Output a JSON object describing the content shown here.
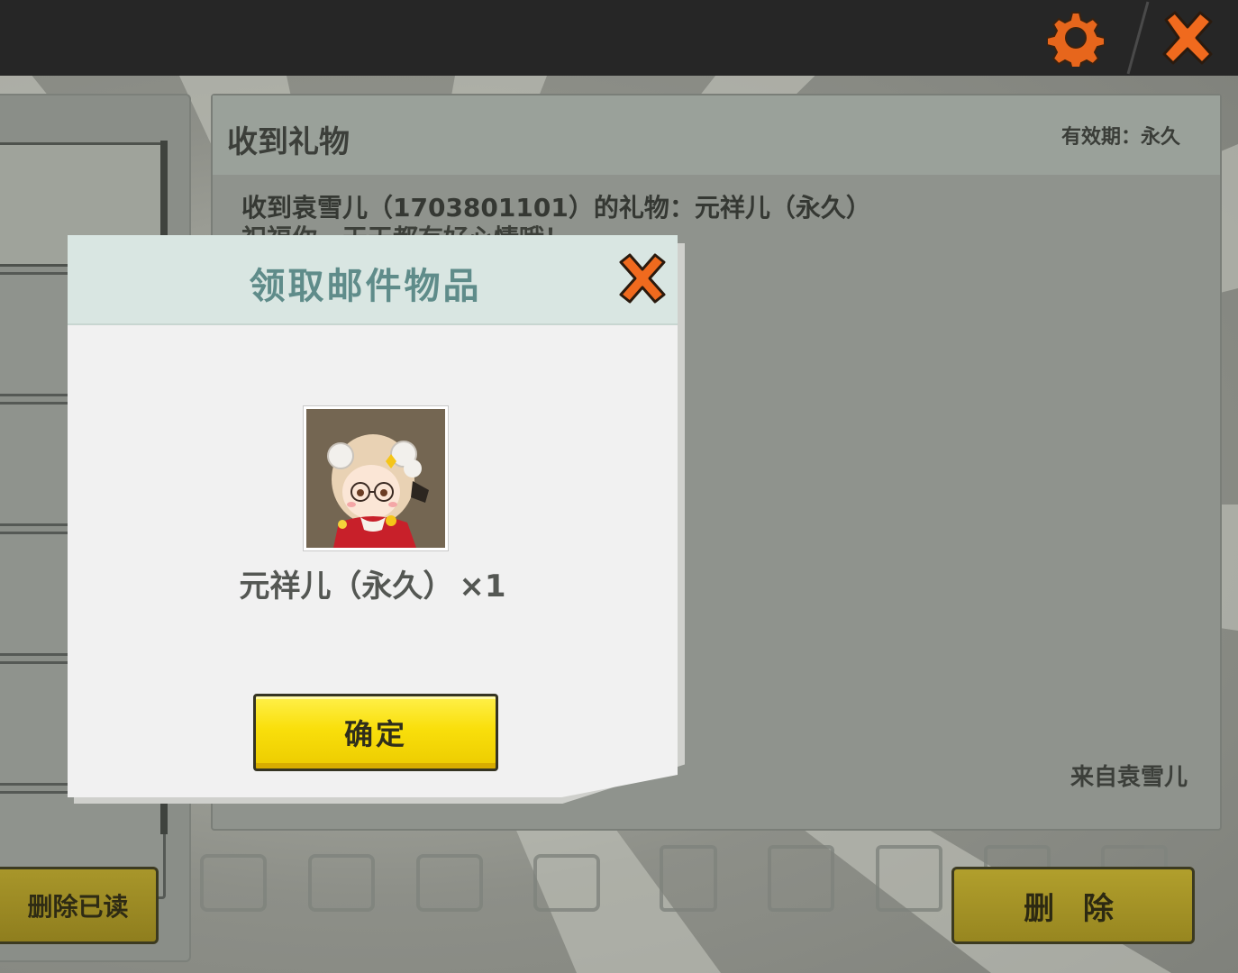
{
  "top_bar": {
    "settings_icon": "gear-icon",
    "close_icon": "close-x-icon",
    "accent_color": "#f06a1e"
  },
  "mail_list": {
    "delete_read_label": "删除已读"
  },
  "mail_detail": {
    "title": "收到礼物",
    "validity": "有效期：永久",
    "body_line1": "收到袁雪儿（1703801101）的礼物：元祥儿（永久）",
    "body_line2": "祝福你，天天都有好心情哦！",
    "sender": "来自袁雪儿",
    "delete_label": "删 除"
  },
  "dialog": {
    "title": "领取邮件物品",
    "close_icon": "close-x-icon",
    "item": {
      "icon": "character-avatar-yuanxianger",
      "name": "元祥儿（永久）",
      "quantity": "×1"
    },
    "confirm_label": "确定",
    "header_color": "#d9e6e2",
    "confirm_color": "#f9df0b"
  }
}
